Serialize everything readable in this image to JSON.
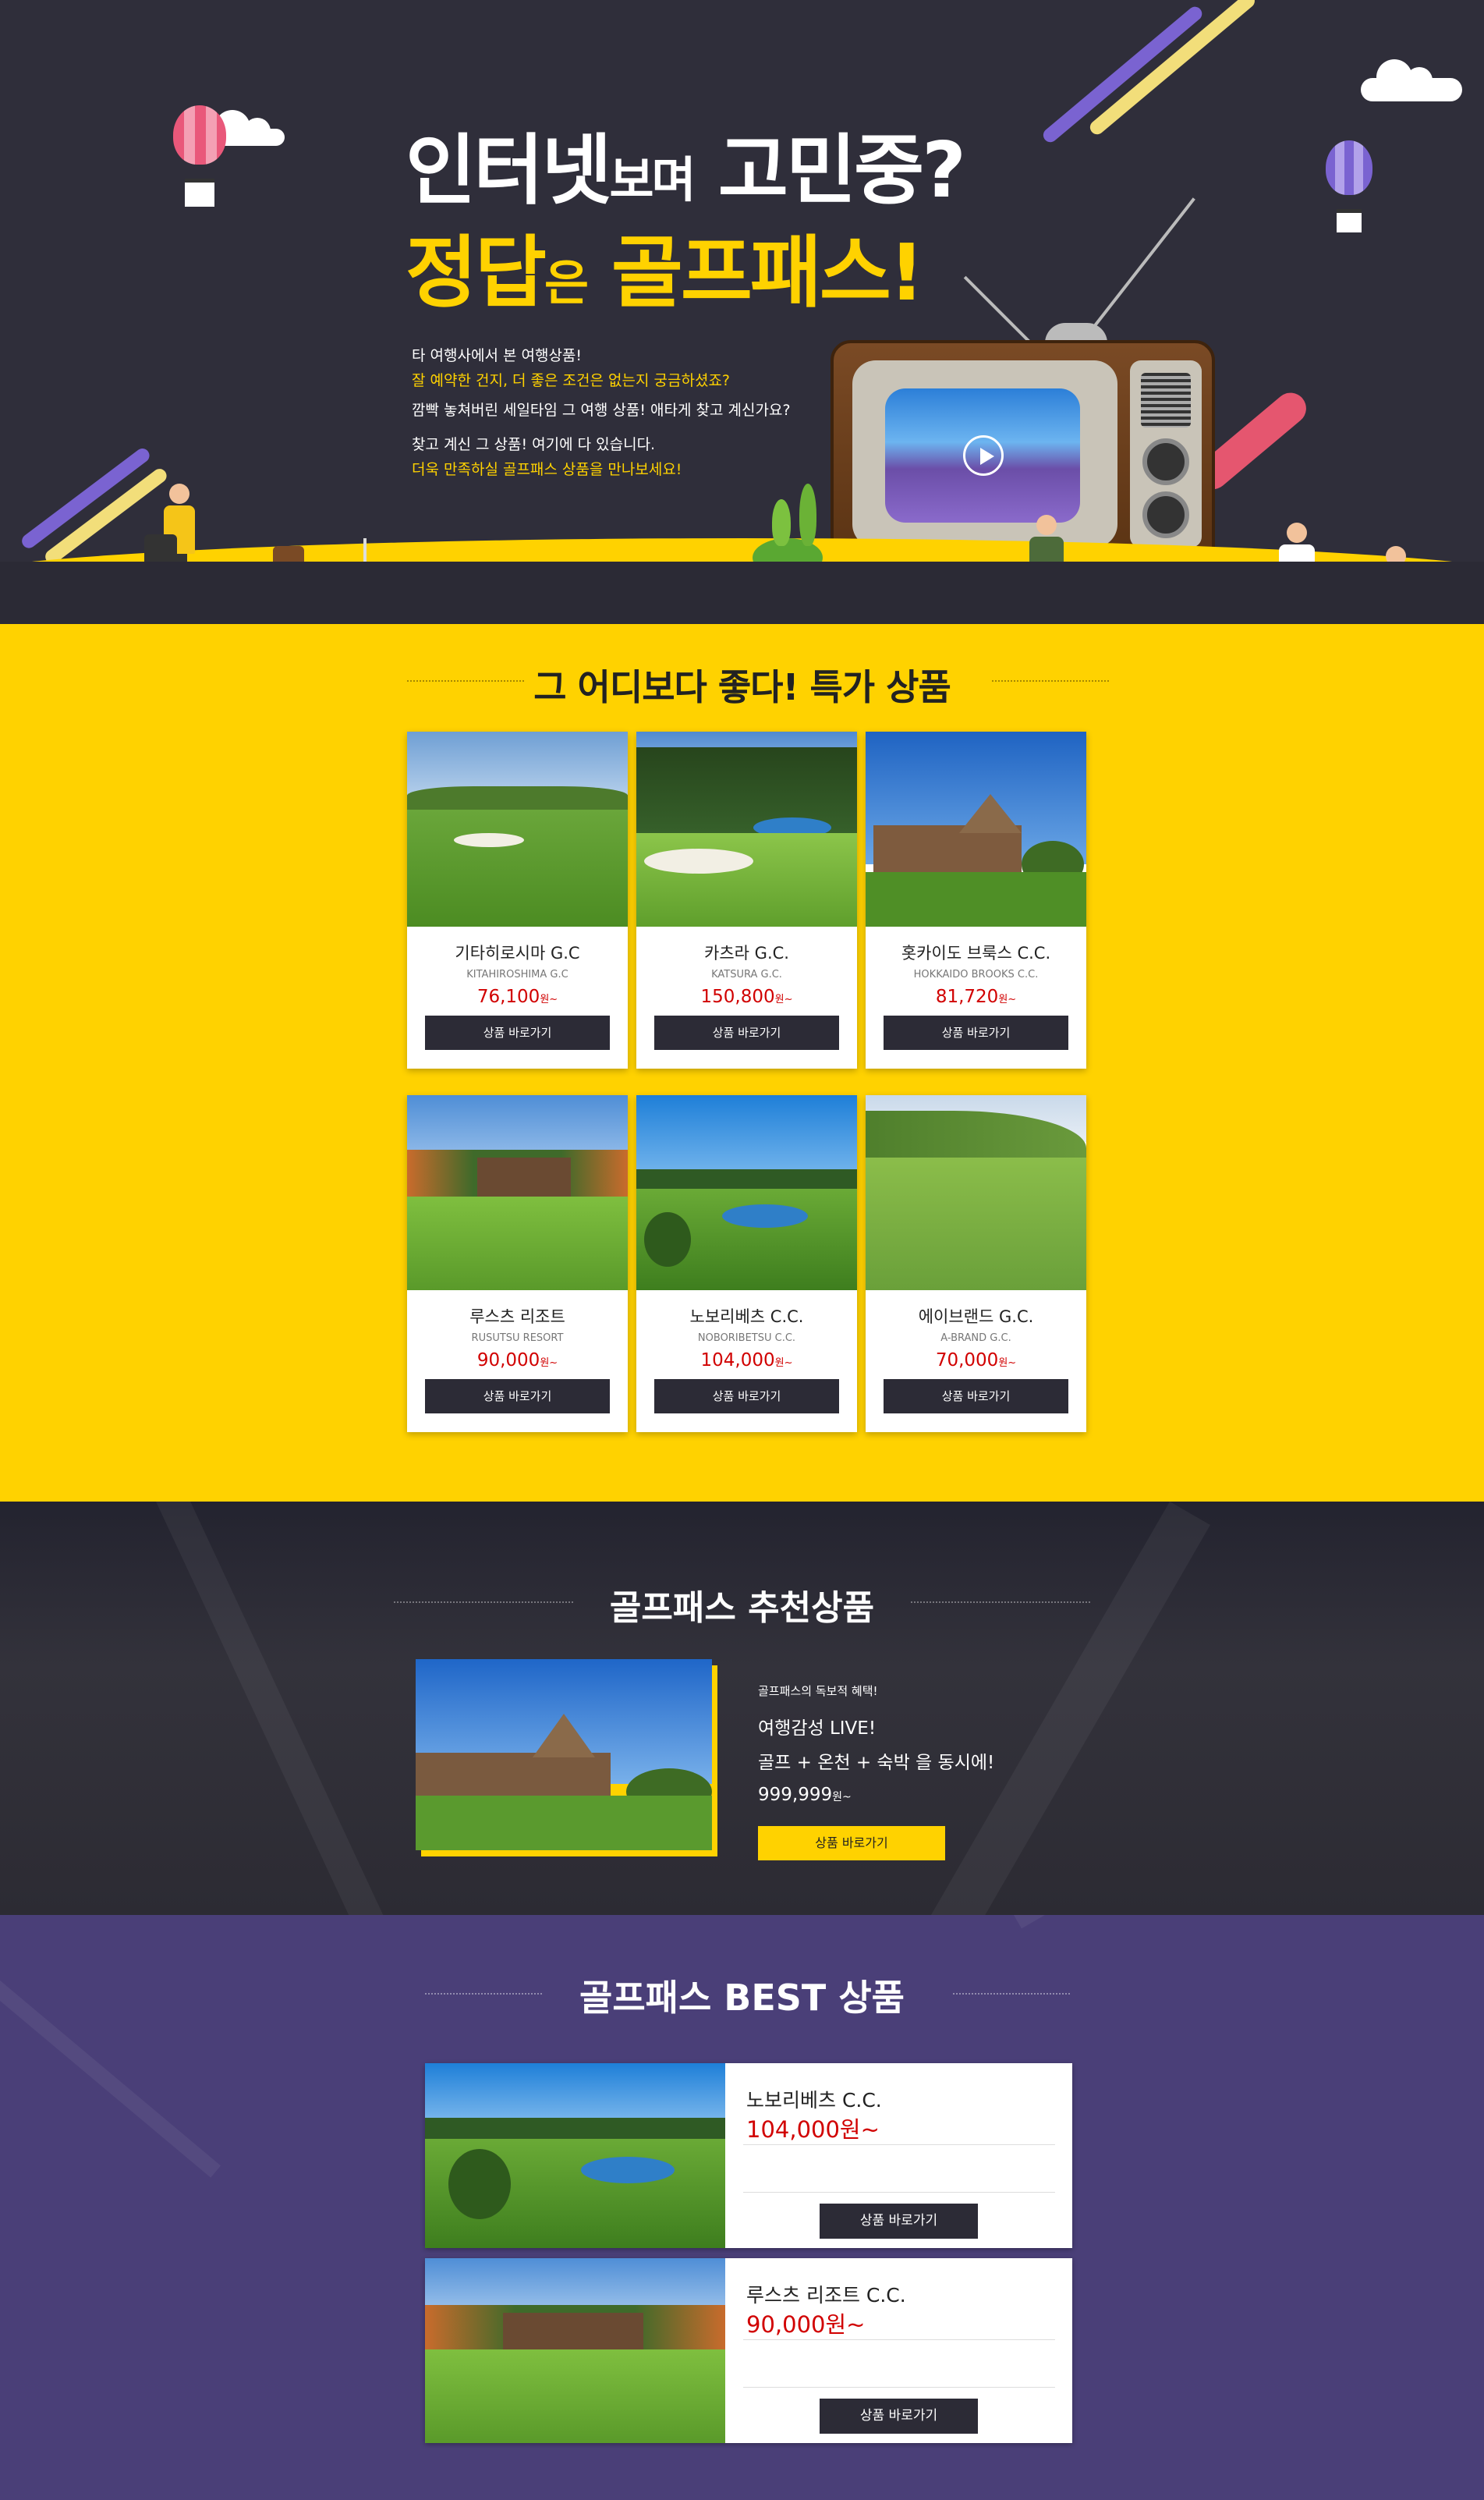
{
  "hero": {
    "title1_main": "인터넷",
    "title1_small": "보며",
    "title1_end": " 고민중?",
    "title2_main": "정답",
    "title2_small": "은",
    "title2_end": " 골프패스!",
    "lines": [
      {
        "text": "타 여행사에서 본 여행상품!",
        "highlight": false
      },
      {
        "text": "잘 예약한 건지, 더 좋은 조건은 없는지 궁금하셨죠?",
        "highlight": true
      },
      {
        "text": "깜빡 놓쳐버린 세일타임 그 여행 상품! 애타게 찾고 계신가요?",
        "highlight": false
      },
      {
        "text": "찾고 계신 그 상품! 여기에 다 있습니다.",
        "highlight": false
      },
      {
        "text": "더욱 만족하실 골프패스 상품을 만나보세요!",
        "highlight": true
      }
    ],
    "colors": {
      "background": "#2f2e3a",
      "accent": "#ffd200"
    }
  },
  "special": {
    "title": "그 어디보다  좋다!  특가 상품",
    "products": [
      {
        "name": "기타히로시마 G.C",
        "ename": "KITAHIROSHIMA G.C",
        "price": "76,100",
        "won": "원~",
        "button": "상품 바로가기"
      },
      {
        "name": "카츠라 G.C.",
        "ename": "KATSURA G.C.",
        "price": "150,800",
        "won": "원~",
        "button": "상품 바로가기"
      },
      {
        "name": "홋카이도 브룩스 C.C.",
        "ename": "HOKKAIDO BROOKS C.C.",
        "price": "81,720",
        "won": "원~",
        "button": "상품 바로가기"
      },
      {
        "name": "루스츠 리조트",
        "ename": "RUSUTSU RESORT",
        "price": "90,000",
        "won": "원~",
        "button": "상품 바로가기"
      },
      {
        "name": "노보리베츠 C.C.",
        "ename": "NOBORIBETSU C.C.",
        "price": "104,000",
        "won": "원~",
        "button": "상품 바로가기"
      },
      {
        "name": "에이브랜드 G.C.",
        "ename": "A-BRAND G.C.",
        "price": "70,000",
        "won": "원~",
        "button": "상품 바로가기"
      }
    ]
  },
  "recommend": {
    "title": "골프패스 추천상품",
    "benefit": "골프패스의 독보적 혜택!",
    "headline": "여행감성 LIVE!",
    "desc": "골프 + 온천 + 숙박 을 동시에!",
    "price": "999,999",
    "won": "원~",
    "button": "상품 바로가기"
  },
  "best": {
    "title": "골프패스 BEST 상품",
    "items": [
      {
        "name": "노보리베츠 C.C.",
        "price": "104,000원~",
        "button": "상품 바로가기"
      },
      {
        "name": "루스츠 리조트 C.C.",
        "price": "90,000원~",
        "button": "상품 바로가기"
      }
    ]
  }
}
